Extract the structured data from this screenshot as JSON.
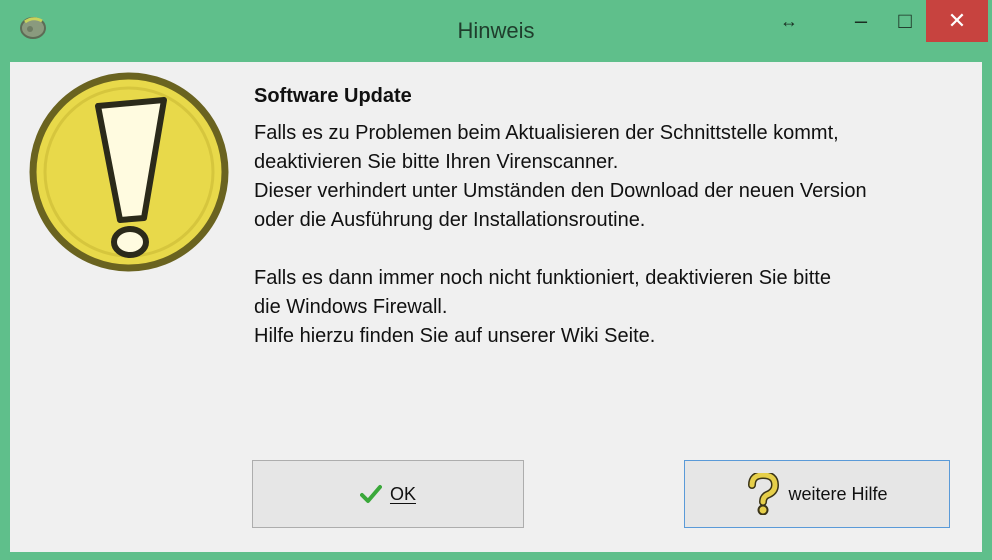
{
  "window": {
    "title": "Hinweis",
    "controls": {
      "resize_icon": "↔",
      "minimize_icon": "–",
      "maximize_icon": "□",
      "close_icon": "✕"
    }
  },
  "message": {
    "heading": "Software Update",
    "paragraph1": "Falls es zu Problemen beim Aktualisieren der Schnittstelle kommt,\ndeaktivieren Sie bitte Ihren Virenscanner.\nDieser verhindert unter Umständen den Download der neuen Version\noder die Ausführung der Installationsroutine.",
    "paragraph2": "Falls es dann immer noch nicht funktioniert, deaktivieren Sie bitte\ndie Windows Firewall.\nHilfe hierzu finden Sie auf unserer Wiki Seite."
  },
  "buttons": {
    "ok_label": "OK",
    "help_label": "weitere Hilfe"
  },
  "icons": {
    "app": "app-icon",
    "warning": "exclamation-warning-icon",
    "ok": "checkmark-icon",
    "help": "question-mark-icon"
  },
  "colors": {
    "titlebar": "#5fbf8b",
    "close": "#c7433f",
    "client": "#f0f0f0",
    "warning_fill": "#e8d94a",
    "help_border": "#5a9ad8"
  }
}
